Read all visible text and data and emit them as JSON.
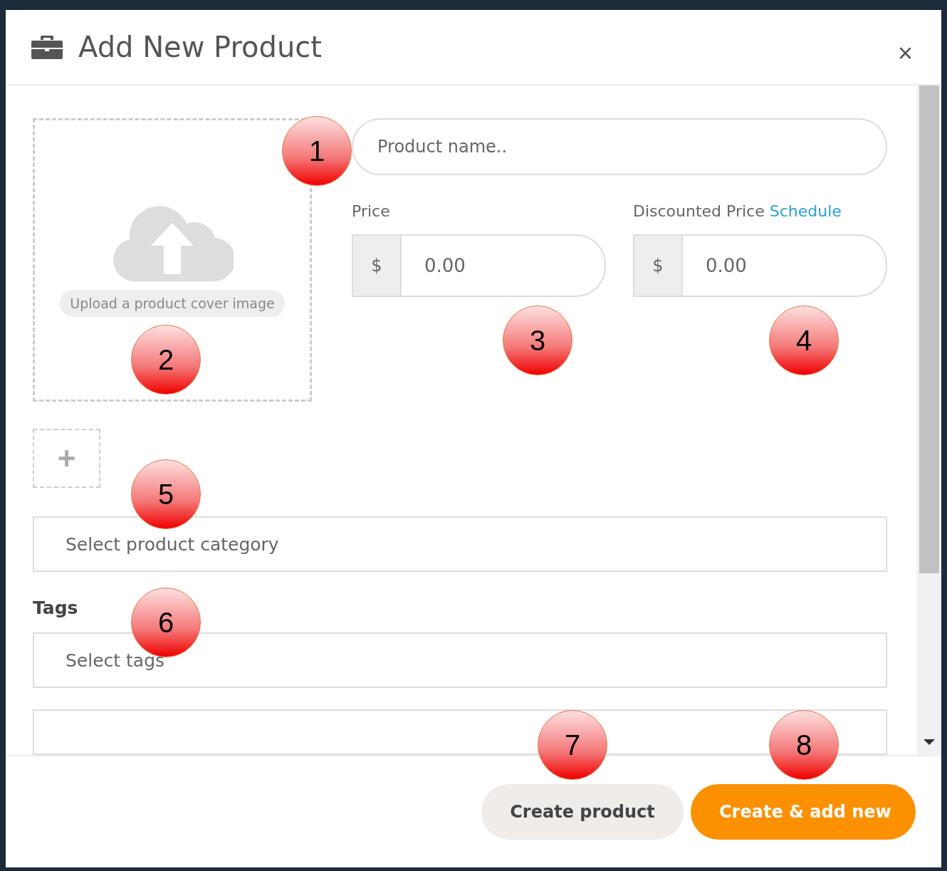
{
  "dialog": {
    "title": "Add New Product",
    "close": "×"
  },
  "upload": {
    "label": "Upload a product cover image",
    "add": "+"
  },
  "name_field": {
    "placeholder": "Product name.."
  },
  "price": {
    "label": "Price",
    "currency": "$",
    "placeholder": "0.00"
  },
  "discounted_price": {
    "label": "Discounted Price",
    "link": "Schedule",
    "currency": "$",
    "placeholder": "0.00"
  },
  "category": {
    "placeholder": "Select product category"
  },
  "tags": {
    "label": "Tags",
    "placeholder": "Select tags"
  },
  "buttons": [
    {
      "label": "Create product",
      "kind": "secondary"
    },
    {
      "label": "Create & add new",
      "kind": "primary"
    }
  ],
  "markers": [
    {
      "label": "1"
    },
    {
      "label": "2"
    },
    {
      "label": "3"
    },
    {
      "label": "4"
    },
    {
      "label": "5"
    },
    {
      "label": "6"
    },
    {
      "label": "7"
    },
    {
      "label": "8"
    }
  ]
}
